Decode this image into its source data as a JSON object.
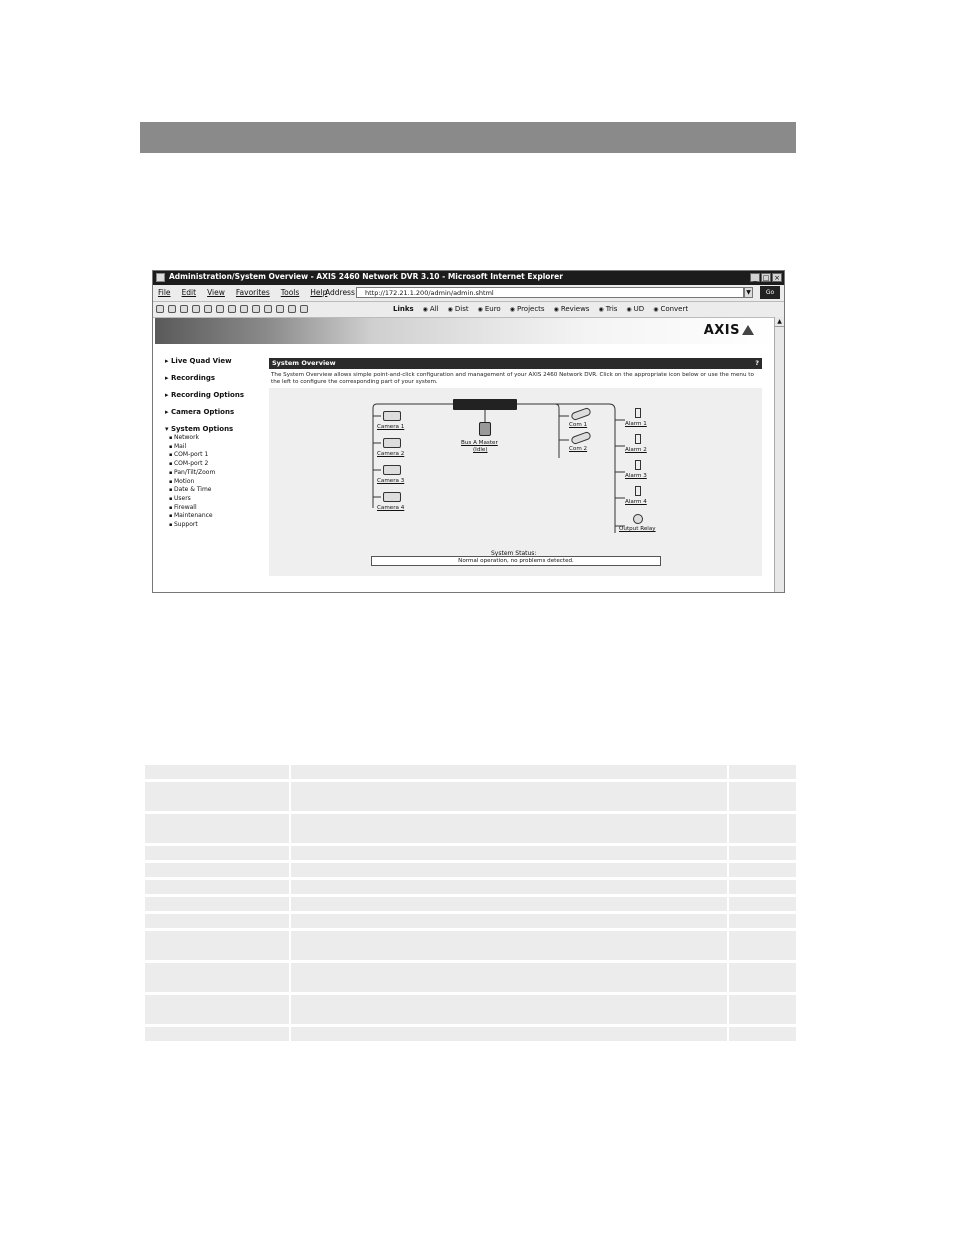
{
  "window": {
    "title": "Administration/System Overview - AXIS 2460 Network DVR 3.10 - Microsoft Internet Explorer",
    "buttons": {
      "minimize": "_",
      "maximize": "□",
      "close": "×"
    }
  },
  "menu": [
    "File",
    "Edit",
    "View",
    "Favorites",
    "Tools",
    "Help"
  ],
  "address": {
    "label": "Address",
    "url": "http://172.21.1.200/admin/admin.shtml",
    "go": "Go"
  },
  "links": [
    "Links",
    "All",
    "Dist",
    "Euro",
    "Projects",
    "Reviews",
    "Tris",
    "UD",
    "Convert"
  ],
  "brand": "AXIS",
  "nav": {
    "live_quad_view": "Live Quad View",
    "recordings": "Recordings",
    "recording_options": "Recording Options",
    "camera_options": "Camera Options",
    "system_options": "System Options",
    "sub_items": [
      "Network",
      "Mail",
      "COM-port 1",
      "COM-port 2",
      "Pan/Tilt/Zoom",
      "Motion",
      "Date & Time",
      "Users",
      "Firewall",
      "Maintenance",
      "Support"
    ]
  },
  "panel": {
    "title": "System Overview",
    "help": "?",
    "description": "The System Overview allows simple point-and-click configuration and management of your AXIS 2460 Network DVR. Click on the appropriate icon below or use the menu to the left to configure the corresponding part of your system."
  },
  "devices": {
    "cameras": [
      "Camera 1",
      "Camera 2",
      "Camera 3",
      "Camera 4"
    ],
    "disk": "Bus A Master",
    "disk_sub": "(Idle)",
    "com": [
      "Com 1",
      "Com 2"
    ],
    "alarms": [
      "Alarm 1",
      "Alarm 2",
      "Alarm 3",
      "Alarm 4"
    ],
    "relay": "Output Relay"
  },
  "status": {
    "label": "System Status:",
    "text": "Normal operation, no problems detected."
  },
  "icons": {
    "app": "ie-icon",
    "dvr": "dvr-icon",
    "camera": "camera-icon",
    "disk": "hard-disk-icon",
    "com": "com-port-icon",
    "alarm": "alarm-input-icon",
    "relay": "output-relay-icon"
  }
}
